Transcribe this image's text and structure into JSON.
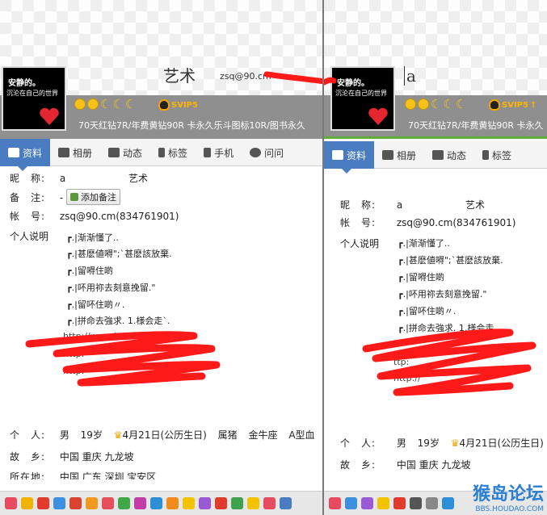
{
  "left": {
    "header": {
      "avatar_line1": "安静的。",
      "avatar_line2": "沉沦在自己的世界",
      "nickname": "艺术",
      "email_partial": "zsq@90.cm",
      "svip": "SVIP5",
      "desc": "70天红钻7R/年费黄钻90R 卡永久乐斗图标10R/图书永久"
    },
    "tabs": [
      "资料",
      "相册",
      "动态",
      "标签",
      "手机",
      "问问"
    ],
    "profile": {
      "nick_label": "昵　称:",
      "nick_value": "a",
      "nick_value2": "艺术",
      "note_label": "备　注:",
      "note_dash": "-",
      "note_btn": "添加备注",
      "account_label": "帐　号:",
      "account_value": "zsq@90.cm(834761901)",
      "sig_label": "个人说明",
      "sig_lines": [
        "┏.|渐渐懂了..",
        "┏.|甚麽値嘚\";`甚麽該放棄.",
        "┏.|留嘚住啲",
        "┏.|吥用祢去刻意挽留.\"",
        "┏.|留吥住啲〃.",
        "┏.|拼命去強求. 1.様会走`."
      ],
      "url1": "http://www.km080.ekas.cn/",
      "url2": "http:",
      "url3": "http:",
      "person_label": "个　人:",
      "gender": "男",
      "age": "19岁",
      "birthday": "4月21日(公历生日)",
      "zodiac": "属猪",
      "constellation": "金牛座",
      "blood": "A型血",
      "home_label": "故　乡:",
      "home_value": "中国 重庆 九龙坡",
      "loc_label": "所在地:",
      "loc_value": "中国 广东 深圳 宝安区"
    }
  },
  "right": {
    "header": {
      "avatar_line1": "安静的。",
      "avatar_line2": "沉沦在自己的世界",
      "nickname": "a",
      "svip": "SVIP5",
      "desc": "70天红钻7R/年费黄钻90R 卡永久"
    },
    "tabs": [
      "资料",
      "相册",
      "动态",
      "标签"
    ],
    "profile": {
      "nick_label": "昵　称:",
      "nick_value": "a",
      "nick_value2": "艺术",
      "account_label": "帐　号:",
      "account_value": "zsq@90.cm(834761901)",
      "sig_label": "个人说明",
      "sig_lines": [
        "┏.|渐渐懂了..",
        "┏.|甚麽値嘚\";`甚麽該放棄.",
        "┏.|留嘚住啲",
        "┏.|吥用祢去刻意挽留.\"",
        "┏.|留吥住啲〃.",
        "┏.|拼命去強求. 1.様会走"
      ],
      "url_partial": "ttp:",
      "url_partial2": "http://",
      "person_label": "个　人:",
      "gender": "男",
      "age": "19岁",
      "birthday": "4月21日(公历生日)",
      "home_label": "故　乡:",
      "home_value": "中国 重庆 九龙坡"
    }
  },
  "watermark": {
    "brand": "猴岛论坛",
    "site": "BBS.HOUDAO.COM"
  },
  "colors": {
    "tab_active": "#4a7cc1",
    "redact": "#ff1a1a",
    "grey_bar": "#8f8f8f"
  }
}
